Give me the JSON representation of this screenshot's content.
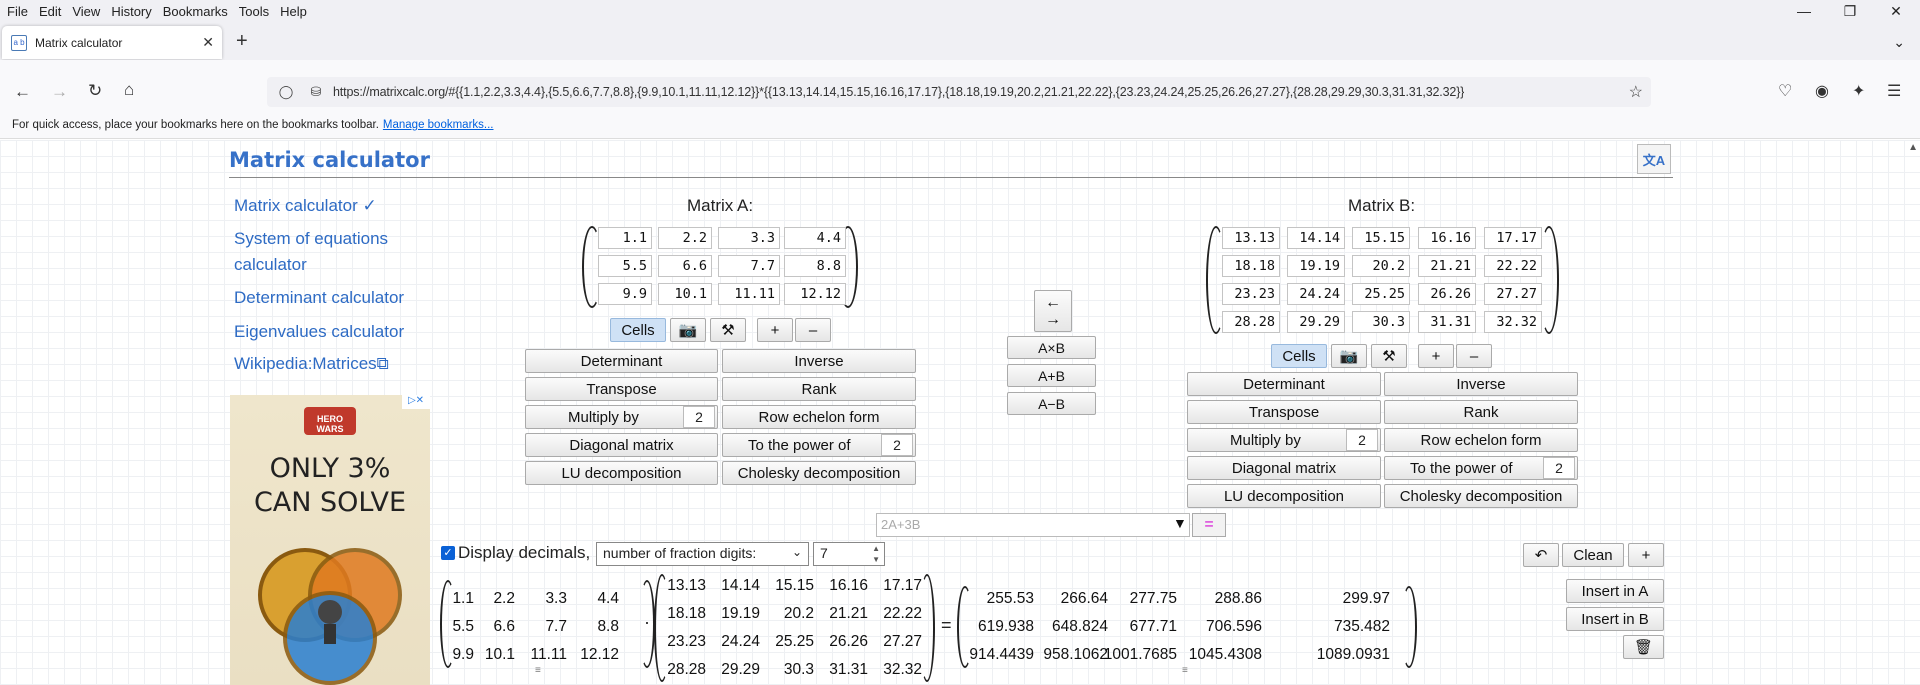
{
  "browser": {
    "menu": [
      "File",
      "Edit",
      "View",
      "History",
      "Bookmarks",
      "Tools",
      "Help"
    ],
    "tab_title": "Matrix calculator",
    "url": "https://matrixcalc.org/#{{1.1,2.2,3.3,4.4},{5.5,6.6,7.7,8.8},{9.9,10.1,11.11,12.12}}*{{13.13,14.14,15.15,16.16,17.17},{18.18,19.19,20.2,21.21,22.22},{23.23,24.24,25.25,26.26,27.27},{28.28,29.29,30.3,31.31,32.32}}",
    "bookmarks_text": "For quick access, place your bookmarks here on the bookmarks toolbar.",
    "bookmarks_link": "Manage bookmarks..."
  },
  "site": {
    "title": "Matrix calculator",
    "lang_icon": "translate-icon",
    "sidebar": [
      {
        "label": "Matrix calculator ✓"
      },
      {
        "label": "System of equations"
      },
      {
        "label": "calculator"
      },
      {
        "label": "Determinant calculator"
      },
      {
        "label": "Eigenvalues calculator"
      },
      {
        "label": "Wikipedia:Matrices⧉"
      }
    ],
    "ad": {
      "line1": "ONLY 3%",
      "line2": "CAN SOLVE",
      "close": "▷✕",
      "brand": "HERO WARS"
    }
  },
  "matrixA": {
    "label": "Matrix A:",
    "rows": [
      [
        "1.1",
        "2.2",
        "3.3",
        "4.4"
      ],
      [
        "5.5",
        "6.6",
        "7.7",
        "8.8"
      ],
      [
        "9.9",
        "10.1",
        "11.11",
        "12.12"
      ]
    ]
  },
  "matrixB": {
    "label": "Matrix B:",
    "rows": [
      [
        "13.13",
        "14.14",
        "15.15",
        "16.16",
        "17.17"
      ],
      [
        "18.18",
        "19.19",
        "20.2",
        "21.21",
        "22.22"
      ],
      [
        "23.23",
        "24.24",
        "25.25",
        "26.26",
        "27.27"
      ],
      [
        "28.28",
        "29.29",
        "30.3",
        "31.31",
        "32.32"
      ]
    ]
  },
  "controls": {
    "cells": "Cells",
    "camera_icon": "camera-icon",
    "brush_icon": "brush-icon",
    "plus": "+",
    "minus": "–",
    "determinant": "Determinant",
    "inverse": "Inverse",
    "transpose": "Transpose",
    "rank": "Rank",
    "multiply_by": "Multiply by",
    "multiply_value": "2",
    "row_echelon": "Row echelon form",
    "diagonal": "Diagonal matrix",
    "power": "To the power of",
    "power_value": "2",
    "lu": "LU decomposition",
    "cholesky": "Cholesky decomposition"
  },
  "middle": {
    "swap": "←\n→",
    "swap_top": "←",
    "swap_bottom": "→",
    "axb": "A×B",
    "apb": "A+B",
    "amb": "A−B"
  },
  "expression": {
    "placeholder": "2A+3B",
    "dropdown_icon": "▼",
    "equals": "="
  },
  "toolbar": {
    "display_decimals": "Display decimals,",
    "fraction_select": "number of fraction digits:",
    "digits": "7",
    "undo_icon": "undo-icon",
    "clean": "Clean",
    "plus": "+",
    "insert_a": "Insert in A",
    "insert_b": "Insert in B",
    "trash_icon": "trash-icon"
  },
  "result": {
    "left": [
      [
        "1.1",
        "2.2",
        "3.3",
        "4.4"
      ],
      [
        "5.5",
        "6.6",
        "7.7",
        "8.8"
      ],
      [
        "9.9",
        "10.1",
        "11.11",
        "12.12"
      ]
    ],
    "right": [
      [
        "13.13",
        "14.14",
        "15.15",
        "16.16",
        "17.17"
      ],
      [
        "18.18",
        "19.19",
        "20.2",
        "21.21",
        "22.22"
      ],
      [
        "23.23",
        "24.24",
        "25.25",
        "26.26",
        "27.27"
      ],
      [
        "28.28",
        "29.29",
        "30.3",
        "31.31",
        "32.32"
      ]
    ],
    "answer": [
      [
        "255.53",
        "266.64",
        "277.75",
        "288.86",
        "299.97"
      ],
      [
        "619.938",
        "648.824",
        "677.71",
        "706.596",
        "735.482"
      ],
      [
        "914.4439",
        "958.1062",
        "1001.7685",
        "1045.4308",
        "1089.0931"
      ]
    ],
    "dot": "·",
    "eq": "="
  }
}
